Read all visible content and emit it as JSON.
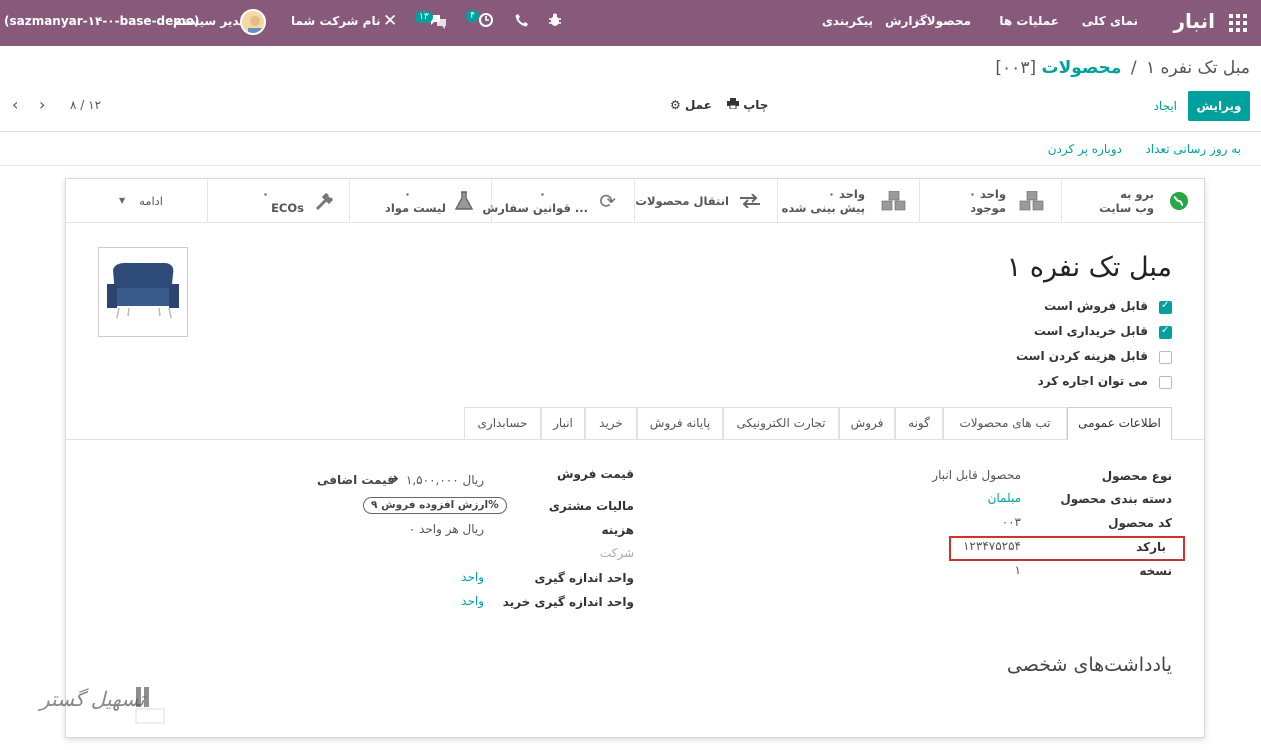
{
  "navbar": {
    "app_title": "انبار",
    "menu": [
      "نمای کلی",
      "عملیات ها",
      "محصولات",
      "گزارش",
      "پیکربندی"
    ],
    "db_name": "(sazmanyar-۱۴-۰-base-demo)",
    "user_name": "مدیر سیستم",
    "company_name": "نام شرکت شما",
    "messages_count": "۱۳",
    "activities_count": "۴"
  },
  "breadcrumb": {
    "parent": "محصولات",
    "separator": "/",
    "current": "[۰۰۳] مبل تک نفره ۱"
  },
  "toolbar": {
    "edit_label": "ویرایش",
    "create_label": "ایجاد",
    "print_label": "چاپ",
    "action_label": "عمل",
    "pager": "۸ / ۱۲"
  },
  "header_buttons": {
    "update_qty": "به روز رسانی تعداد",
    "replenish": "دوباره پر کردن"
  },
  "smart_buttons": {
    "website": [
      "برو به",
      "وب سایت"
    ],
    "onhand": [
      "۰ واحد",
      "موجود"
    ],
    "forecast": [
      "۰ واحد",
      "پیش بینی شده"
    ],
    "moves": "انتقال محصولات",
    "reorder": [
      "۰",
      "قوانین سفارش ..."
    ],
    "bom": [
      "۰",
      "لیست مواد"
    ],
    "ecos": [
      "۰",
      "ECOs"
    ],
    "more": "ادامه"
  },
  "product": {
    "name": "مبل تک نفره ۱",
    "checkboxes": [
      {
        "label": "قابل فروش است",
        "checked": true
      },
      {
        "label": "قابل خریداری است",
        "checked": true
      },
      {
        "label": "قابل هزینه کردن است",
        "checked": false
      },
      {
        "label": "می توان اجاره کرد",
        "checked": false
      }
    ]
  },
  "tabs": [
    "اطلاعات عمومی",
    "تب های محصولات",
    "گونه",
    "فروش",
    "تجارت الکترونیکی",
    "پایانه فروش",
    "خرید",
    "انبار",
    "حسابداری"
  ],
  "general": {
    "type_label": "نوع محصول",
    "type_value": "محصول قابل انبار",
    "category_label": "دسته بندی محصول",
    "category_value": "مبلمان",
    "code_label": "کد محصول",
    "code_value": "۰۰۳",
    "barcode_label": "بارکد",
    "barcode_value": "۱۲۳۴۷۵۲۵۴",
    "version_label": "نسخه",
    "version_value": "۱",
    "sale_price_label": "قیمت فروش",
    "sale_price_value": "۱,۵۰۰,۰۰۰ ریال",
    "extra_price": "قیمت اضافی",
    "tax_label": "مالیات مشتری",
    "tax_tag": "ارزش افزوده فروش ۹%",
    "cost_label": "هزینه",
    "cost_value": "۰ ریال هر واحد",
    "company_label": "شرکت",
    "uom_label": "واحد اندازه گیری",
    "uom_value": "واحد",
    "puom_label": "واحد اندازه گیری خرید",
    "puom_value": "واحد"
  },
  "notes_title": "یادداشت‌های شخصی",
  "watermark": "تسهیل گستر",
  "colors": {
    "brand": "#875a7b",
    "accent": "#00a09d",
    "highlight": "#d32f2f"
  }
}
